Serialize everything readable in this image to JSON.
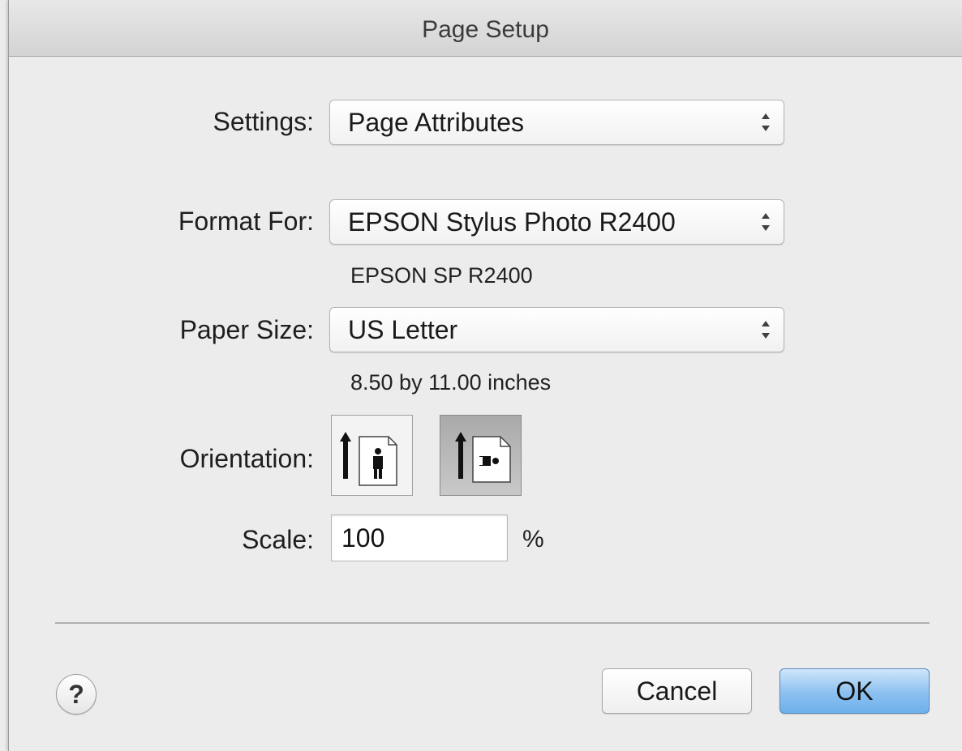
{
  "window": {
    "title": "Page Setup"
  },
  "settings": {
    "label": "Settings:",
    "value": "Page Attributes"
  },
  "format_for": {
    "label": "Format For:",
    "value": "EPSON Stylus Photo R2400",
    "subtext": "EPSON SP R2400"
  },
  "paper_size": {
    "label": "Paper Size:",
    "value": "US Letter",
    "subtext": "8.50 by 11.00 inches"
  },
  "orientation": {
    "label": "Orientation:",
    "options": [
      "portrait",
      "landscape"
    ],
    "selected": "landscape"
  },
  "scale": {
    "label": "Scale:",
    "value": "100",
    "unit": "%"
  },
  "buttons": {
    "help": "?",
    "cancel": "Cancel",
    "ok": "OK"
  },
  "colors": {
    "ok_button": "#8bc0ef",
    "selected_orientation": "#a9a9a9"
  },
  "icons": {
    "portrait": "portrait-orientation-icon",
    "landscape": "landscape-orientation-icon",
    "popup_arrows": "updown-arrows-icon"
  }
}
